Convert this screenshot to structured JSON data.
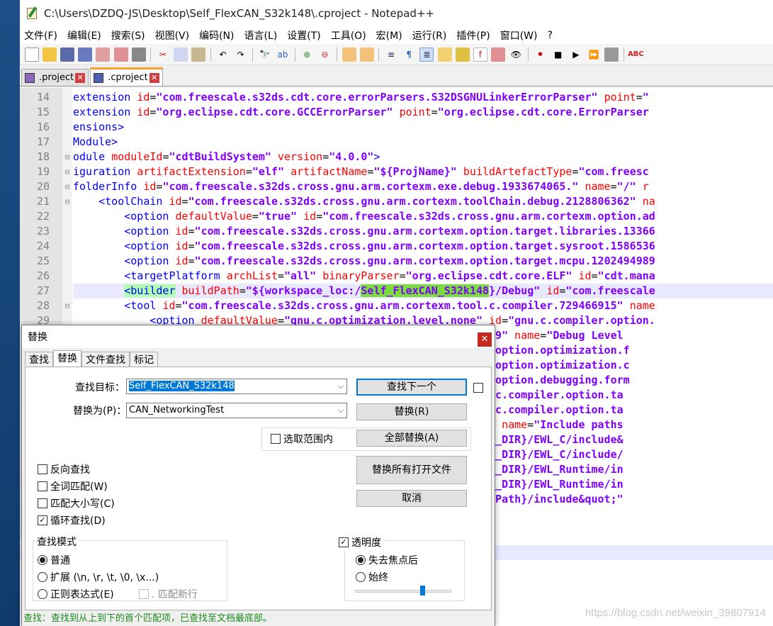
{
  "window": {
    "title": "C:\\Users\\DZDQ-JS\\Desktop\\Self_FlexCAN_S32k148\\.cproject - Notepad++"
  },
  "menu": [
    "文件(F)",
    "编辑(E)",
    "搜索(S)",
    "视图(V)",
    "编码(N)",
    "语言(L)",
    "设置(T)",
    "工具(O)",
    "宏(M)",
    "运行(R)",
    "插件(P)",
    "窗口(W)",
    "?"
  ],
  "tabs": [
    {
      "label": ".project",
      "active": false
    },
    {
      "label": ".cproject",
      "active": true
    }
  ],
  "editor": {
    "lines": [
      {
        "n": "14",
        "fold": "",
        "html": "<span class='t'>extension</span> <span class='a'>id</span><span class='p'>=</span><span class='v'>\"com.freescale.s32ds.cdt.core.errorParsers.S32DSGNULinkerErrorParser\"</span> <span class='a'>point</span><span class='p'>=</span><span class='v'>\"</span>"
      },
      {
        "n": "15",
        "fold": "",
        "html": "<span class='t'>extension</span> <span class='a'>id</span><span class='p'>=</span><span class='v'>\"org.eclipse.cdt.core.GCCErrorParser\"</span> <span class='a'>point</span><span class='p'>=</span><span class='v'>\"org.eclipse.cdt.core.ErrorParser</span>"
      },
      {
        "n": "16",
        "fold": "",
        "html": "<span class='t'>ensions&gt;</span>"
      },
      {
        "n": "17",
        "fold": "",
        "html": "<span class='t'>Module&gt;</span>"
      },
      {
        "n": "18",
        "fold": "⊟",
        "html": "<span class='t'>odule</span> <span class='a'>moduleId</span><span class='p'>=</span><span class='v'>\"cdtBuildSystem\"</span> <span class='a'>version</span><span class='p'>=</span><span class='v'>\"4.0.0\"</span><span class='t'>&gt;</span>"
      },
      {
        "n": "19",
        "fold": "⊟",
        "html": "<span class='t'>iguration</span> <span class='a'>artifactExtension</span><span class='p'>=</span><span class='v'>\"elf\"</span> <span class='a'>artifactName</span><span class='p'>=</span><span class='v'>\"${ProjName}\"</span> <span class='a'>buildArtefactType</span><span class='p'>=</span><span class='v'>\"com.freesc</span>"
      },
      {
        "n": "20",
        "fold": "⊟",
        "html": "<span class='t'>folderInfo</span> <span class='a'>id</span><span class='p'>=</span><span class='v'>\"com.freescale.s32ds.cross.gnu.arm.cortexm.exe.debug.1933674065.\"</span> <span class='a'>name</span><span class='p'>=</span><span class='v'>\"/\"</span> <span class='a'>r</span>"
      },
      {
        "n": "21",
        "fold": "⊟",
        "html": "    <span class='t'>&lt;toolChain</span> <span class='a'>id</span><span class='p'>=</span><span class='v'>\"com.freescale.s32ds.cross.gnu.arm.cortexm.toolChain.debug.2128806362\"</span> <span class='a'>na</span>"
      },
      {
        "n": "22",
        "fold": "",
        "html": "        <span class='t'>&lt;option</span> <span class='a'>defaultValue</span><span class='p'>=</span><span class='v'>\"true\"</span> <span class='a'>id</span><span class='p'>=</span><span class='v'>\"com.freescale.s32ds.cross.gnu.arm.cortexm.option.ad</span>"
      },
      {
        "n": "23",
        "fold": "",
        "html": "        <span class='t'>&lt;option</span> <span class='a'>id</span><span class='p'>=</span><span class='v'>\"com.freescale.s32ds.cross.gnu.arm.cortexm.option.target.libraries.13366</span>"
      },
      {
        "n": "24",
        "fold": "",
        "html": "        <span class='t'>&lt;option</span> <span class='a'>id</span><span class='p'>=</span><span class='v'>\"com.freescale.s32ds.cross.gnu.arm.cortexm.option.target.sysroot.1586536</span>"
      },
      {
        "n": "25",
        "fold": "",
        "html": "        <span class='t'>&lt;option</span> <span class='a'>id</span><span class='p'>=</span><span class='v'>\"com.freescale.s32ds.cross.gnu.arm.cortexm.option.target.mcpu.1202494989</span>"
      },
      {
        "n": "26",
        "fold": "",
        "html": "        <span class='t'>&lt;targetPlatform</span> <span class='a'>archList</span><span class='p'>=</span><span class='v'>\"all\"</span> <span class='a'>binaryParser</span><span class='p'>=</span><span class='v'>\"org.eclipse.cdt.core.ELF\"</span> <span class='a'>id</span><span class='p'>=</span><span class='v'>\"cdt.mana</span>"
      },
      {
        "n": "27",
        "fold": "",
        "cur": true,
        "html": "        <span class='t mk'>&lt;builder</span> <span class='a'>buildPath</span><span class='p'>=</span><span class='v'>\"${workspace_loc:/<span class='hl'>Self_FlexCAN_S32k148</span>}/Debug\"</span> <span class='a'>id</span><span class='p'>=</span><span class='v'>\"com.freescale</span>"
      },
      {
        "n": "28",
        "fold": "⊟",
        "html": "        <span class='t'>&lt;tool</span> <span class='a'>id</span><span class='p'>=</span><span class='v'>\"com.freescale.s32ds.cross.gnu.arm.cortexm.tool.c.compiler.729466915\"</span> <span class='a'>name</span>"
      },
      {
        "n": "29",
        "fold": "",
        "html": "            <span class='t'>&lt;option</span> <span class='a'>defaultValue</span><span class='p'>=</span><span class='v'>\"gnu.c.optimization.level.none\"</span> <span class='a'>id</span><span class='p'>=</span><span class='v'>\"gnu.c.compiler.option.</span>"
      },
      {
        "n": "30",
        "fold": "",
        "html": "                                                  <span class='v'>.level.1868797469\"</span> <span class='a'>name</span><span class='p'>=</span><span class='v'>\"Debug Level</span>"
      },
      {
        "n": "31",
        "fold": "",
        "html": "                                                  <span class='v'>tool.c.compiler.option.optimization.f</span>"
      },
      {
        "n": "32",
        "fold": "",
        "html": "                                                  <span class='v'>tool.c.compiler.option.optimization.c</span>"
      },
      {
        "n": "33",
        "fold": "",
        "html": "                                                  <span class='v'>tool.c.compiler.option.debugging.form</span>"
      },
      {
        "n": "34",
        "fold": "",
        "html": "                                                  <span class='v'>rm.cortexm.tool.c.compiler.option.ta</span>"
      },
      {
        "n": "35",
        "fold": "",
        "html": "                                                  <span class='v'>rm.cortexm.tool.c.compiler.option.ta</span>"
      },
      {
        "n": "36",
        "fold": "",
        "html": "                                                  <span class='v'>aths.1977168491\"</span> <span class='a'>name</span><span class='p'>=</span><span class='v'>\"Include paths</span>"
      },
      {
        "n": "37",
        "fold": "",
        "html": "                                                  <span class='v'>\"&amp;quot;${ARM_EWL_DIR}/EWL_C/include&amp;</span>"
      },
      {
        "n": "38",
        "fold": "",
        "html": "                                                  <span class='v'>\"&amp;quot;${ARM_EWL_DIR}/EWL_C/include/</span>"
      },
      {
        "n": "39",
        "fold": "",
        "html": "                                                  <span class='v'>\"&amp;quot;${ARM_EWL_DIR}/EWL_Runtime/in</span>"
      },
      {
        "n": "40",
        "fold": "",
        "html": "                                                  <span class='v'>\"&amp;quot;${ARM_EWL_DIR}/EWL_Runtime/in</span>"
      },
      {
        "n": "41",
        "fold": "",
        "html": "                                                  <span class='v'>\"&amp;quot;${ProjDirPath}/include&amp;quot;\"</span>"
      }
    ]
  },
  "dialog": {
    "title": "替换",
    "tabs": [
      "查找",
      "替换",
      "文件查找",
      "标记"
    ],
    "find_label": "查找目标：",
    "find_value": "Self_FlexCAN_S32k148",
    "replace_label": "替换为(P)：",
    "replace_value": "CAN_NetworkingTest",
    "btn_find_next": "查找下一个",
    "btn_replace": "替换(R)",
    "btn_replace_all": "全部替换(A)",
    "btn_replace_all_open": "替换所有打开文件",
    "btn_cancel": "取消",
    "in_selection": "选取范围内",
    "opt_backward": "反向查找",
    "opt_whole_word": "全词匹配(W)",
    "opt_match_case": "匹配大小写(C)",
    "opt_wrap": "循环查找(D)",
    "search_mode_title": "查找模式",
    "mode_normal": "普通",
    "mode_extended": "扩展 (\\n, \\r, \\t, \\0, \\x...)",
    "mode_regex": "正则表达式(E)",
    "mode_dot_newline": ". 匹配新行",
    "transparency_title": "透明度",
    "trans_on_lose_focus": "失去焦点后",
    "trans_always": "始终",
    "transparency_level": 0.7,
    "status": "查找：查找到从上到下的首个匹配项，已查找至文档最底部。"
  },
  "watermark": "https://blog.csdn.net/weixin_39807914",
  "colors": {
    "tag": "#0000ff",
    "attr": "#ff0000",
    "value": "#8000ff",
    "highlight": "#7bdc3c",
    "accent": "#0078d7"
  }
}
